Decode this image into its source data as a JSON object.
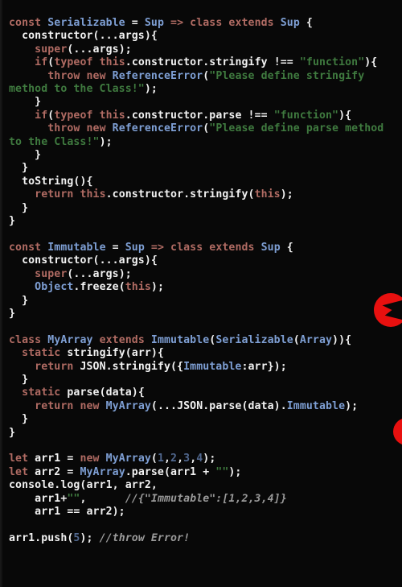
{
  "editor": {
    "language": "javascript",
    "theme": "dark",
    "background_color": "#080808",
    "foreground_color": "#f2f2f2",
    "palette": {
      "keyword": "#b06b63",
      "type": "#7e9fd4",
      "string": "#3f7a3f",
      "number": "#51688f",
      "comment": "#9a9a9a",
      "plain": "#f2f2f2"
    }
  },
  "overlay": {
    "logos": [
      {
        "name": "red-circle-logo-upper",
        "color": "#e8100f"
      },
      {
        "name": "red-circle-logo-lower",
        "color": "#e8100f"
      }
    ]
  },
  "code": {
    "lines": [
      {
        "n": 1,
        "tokens": [
          {
            "t": "const",
            "c": "kw"
          },
          {
            "t": " ",
            "c": "plain"
          },
          {
            "t": "Serializable",
            "c": "type"
          },
          {
            "t": " = ",
            "c": "plain"
          },
          {
            "t": "Sup",
            "c": "type"
          },
          {
            "t": " ",
            "c": "plain"
          },
          {
            "t": "=>",
            "c": "kw"
          },
          {
            "t": " ",
            "c": "plain"
          },
          {
            "t": "class",
            "c": "kw"
          },
          {
            "t": " ",
            "c": "plain"
          },
          {
            "t": "extends",
            "c": "kw"
          },
          {
            "t": " ",
            "c": "plain"
          },
          {
            "t": "Sup",
            "c": "type"
          },
          {
            "t": " {",
            "c": "plain"
          }
        ]
      },
      {
        "n": 2,
        "tokens": [
          {
            "t": "  constructor(...args){",
            "c": "plain"
          }
        ]
      },
      {
        "n": 3,
        "tokens": [
          {
            "t": "    ",
            "c": "plain"
          },
          {
            "t": "super",
            "c": "kw"
          },
          {
            "t": "(...args);",
            "c": "plain"
          }
        ]
      },
      {
        "n": 4,
        "tokens": [
          {
            "t": "    ",
            "c": "plain"
          },
          {
            "t": "if",
            "c": "kw"
          },
          {
            "t": "(",
            "c": "plain"
          },
          {
            "t": "typeof",
            "c": "kw"
          },
          {
            "t": " ",
            "c": "plain"
          },
          {
            "t": "this",
            "c": "kw"
          },
          {
            "t": ".constructor.stringify !== ",
            "c": "plain"
          },
          {
            "t": "\"function\"",
            "c": "str"
          },
          {
            "t": "){",
            "c": "plain"
          }
        ]
      },
      {
        "n": 5,
        "tokens": [
          {
            "t": "      ",
            "c": "plain"
          },
          {
            "t": "throw",
            "c": "kw"
          },
          {
            "t": " ",
            "c": "plain"
          },
          {
            "t": "new",
            "c": "kw"
          },
          {
            "t": " ",
            "c": "plain"
          },
          {
            "t": "ReferenceError",
            "c": "type"
          },
          {
            "t": "(",
            "c": "plain"
          },
          {
            "t": "\"Please define stringify method to the Class!\"",
            "c": "str"
          },
          {
            "t": ");",
            "c": "plain"
          }
        ]
      },
      {
        "n": 6,
        "tokens": [
          {
            "t": "    }",
            "c": "plain"
          }
        ]
      },
      {
        "n": 7,
        "tokens": [
          {
            "t": "    ",
            "c": "plain"
          },
          {
            "t": "if",
            "c": "kw"
          },
          {
            "t": "(",
            "c": "plain"
          },
          {
            "t": "typeof",
            "c": "kw"
          },
          {
            "t": " ",
            "c": "plain"
          },
          {
            "t": "this",
            "c": "kw"
          },
          {
            "t": ".constructor.parse !== ",
            "c": "plain"
          },
          {
            "t": "\"function\"",
            "c": "str"
          },
          {
            "t": "){",
            "c": "plain"
          }
        ]
      },
      {
        "n": 8,
        "tokens": [
          {
            "t": "      ",
            "c": "plain"
          },
          {
            "t": "throw",
            "c": "kw"
          },
          {
            "t": " ",
            "c": "plain"
          },
          {
            "t": "new",
            "c": "kw"
          },
          {
            "t": " ",
            "c": "plain"
          },
          {
            "t": "ReferenceError",
            "c": "type"
          },
          {
            "t": "(",
            "c": "plain"
          },
          {
            "t": "\"Please define parse method to the Class!\"",
            "c": "str"
          },
          {
            "t": ");",
            "c": "plain"
          }
        ]
      },
      {
        "n": 9,
        "tokens": [
          {
            "t": "    }",
            "c": "plain"
          }
        ]
      },
      {
        "n": 10,
        "tokens": [
          {
            "t": "  }",
            "c": "plain"
          }
        ]
      },
      {
        "n": 11,
        "tokens": [
          {
            "t": "  toString(){",
            "c": "plain"
          }
        ]
      },
      {
        "n": 12,
        "tokens": [
          {
            "t": "    ",
            "c": "plain"
          },
          {
            "t": "return",
            "c": "kw"
          },
          {
            "t": " ",
            "c": "plain"
          },
          {
            "t": "this",
            "c": "kw"
          },
          {
            "t": ".constructor.stringify(",
            "c": "plain"
          },
          {
            "t": "this",
            "c": "kw"
          },
          {
            "t": ");",
            "c": "plain"
          }
        ]
      },
      {
        "n": 13,
        "tokens": [
          {
            "t": "  }",
            "c": "plain"
          }
        ]
      },
      {
        "n": 14,
        "tokens": [
          {
            "t": "}",
            "c": "plain"
          }
        ]
      },
      {
        "n": 15,
        "tokens": []
      },
      {
        "n": 16,
        "tokens": [
          {
            "t": "const",
            "c": "kw"
          },
          {
            "t": " ",
            "c": "plain"
          },
          {
            "t": "Immutable",
            "c": "type"
          },
          {
            "t": " = ",
            "c": "plain"
          },
          {
            "t": "Sup",
            "c": "type"
          },
          {
            "t": " ",
            "c": "plain"
          },
          {
            "t": "=>",
            "c": "kw"
          },
          {
            "t": " ",
            "c": "plain"
          },
          {
            "t": "class",
            "c": "kw"
          },
          {
            "t": " ",
            "c": "plain"
          },
          {
            "t": "extends",
            "c": "kw"
          },
          {
            "t": " ",
            "c": "plain"
          },
          {
            "t": "Sup",
            "c": "type"
          },
          {
            "t": " {",
            "c": "plain"
          }
        ]
      },
      {
        "n": 17,
        "tokens": [
          {
            "t": "  constructor(...args){",
            "c": "plain"
          }
        ]
      },
      {
        "n": 18,
        "tokens": [
          {
            "t": "    ",
            "c": "plain"
          },
          {
            "t": "super",
            "c": "kw"
          },
          {
            "t": "(...args);",
            "c": "plain"
          }
        ]
      },
      {
        "n": 19,
        "tokens": [
          {
            "t": "    ",
            "c": "plain"
          },
          {
            "t": "Object",
            "c": "type"
          },
          {
            "t": ".freeze(",
            "c": "plain"
          },
          {
            "t": "this",
            "c": "kw"
          },
          {
            "t": ");",
            "c": "plain"
          }
        ]
      },
      {
        "n": 20,
        "tokens": [
          {
            "t": "  }",
            "c": "plain"
          }
        ]
      },
      {
        "n": 21,
        "tokens": [
          {
            "t": "}",
            "c": "plain"
          }
        ]
      },
      {
        "n": 22,
        "tokens": []
      },
      {
        "n": 23,
        "tokens": [
          {
            "t": "class",
            "c": "kw"
          },
          {
            "t": " ",
            "c": "plain"
          },
          {
            "t": "MyArray",
            "c": "type"
          },
          {
            "t": " ",
            "c": "plain"
          },
          {
            "t": "extends",
            "c": "kw"
          },
          {
            "t": " ",
            "c": "plain"
          },
          {
            "t": "Immutable",
            "c": "type"
          },
          {
            "t": "(",
            "c": "plain"
          },
          {
            "t": "Serializable",
            "c": "type"
          },
          {
            "t": "(",
            "c": "plain"
          },
          {
            "t": "Array",
            "c": "type"
          },
          {
            "t": ")){",
            "c": "plain"
          }
        ]
      },
      {
        "n": 24,
        "tokens": [
          {
            "t": "  ",
            "c": "plain"
          },
          {
            "t": "static",
            "c": "kw"
          },
          {
            "t": " stringify(arr){",
            "c": "plain"
          }
        ]
      },
      {
        "n": 25,
        "tokens": [
          {
            "t": "    ",
            "c": "plain"
          },
          {
            "t": "return",
            "c": "kw"
          },
          {
            "t": " JSON.stringify({",
            "c": "plain"
          },
          {
            "t": "Immutable",
            "c": "type"
          },
          {
            "t": ":arr});",
            "c": "plain"
          }
        ]
      },
      {
        "n": 26,
        "tokens": [
          {
            "t": "  }",
            "c": "plain"
          }
        ]
      },
      {
        "n": 27,
        "tokens": [
          {
            "t": "  ",
            "c": "plain"
          },
          {
            "t": "static",
            "c": "kw"
          },
          {
            "t": " parse(data){",
            "c": "plain"
          }
        ]
      },
      {
        "n": 28,
        "tokens": [
          {
            "t": "    ",
            "c": "plain"
          },
          {
            "t": "return",
            "c": "kw"
          },
          {
            "t": " ",
            "c": "plain"
          },
          {
            "t": "new",
            "c": "kw"
          },
          {
            "t": " ",
            "c": "plain"
          },
          {
            "t": "MyArray",
            "c": "type"
          },
          {
            "t": "(...JSON.parse(data).",
            "c": "plain"
          },
          {
            "t": "Immutable",
            "c": "type"
          },
          {
            "t": ");",
            "c": "plain"
          }
        ]
      },
      {
        "n": 29,
        "tokens": [
          {
            "t": "  }",
            "c": "plain"
          }
        ]
      },
      {
        "n": 30,
        "tokens": [
          {
            "t": "}",
            "c": "plain"
          }
        ]
      },
      {
        "n": 31,
        "tokens": []
      },
      {
        "n": 32,
        "tokens": [
          {
            "t": "let",
            "c": "kw"
          },
          {
            "t": " arr1 = ",
            "c": "plain"
          },
          {
            "t": "new",
            "c": "kw"
          },
          {
            "t": " ",
            "c": "plain"
          },
          {
            "t": "MyArray",
            "c": "type"
          },
          {
            "t": "(",
            "c": "plain"
          },
          {
            "t": "1",
            "c": "num"
          },
          {
            "t": ",",
            "c": "plain"
          },
          {
            "t": "2",
            "c": "num"
          },
          {
            "t": ",",
            "c": "plain"
          },
          {
            "t": "3",
            "c": "num"
          },
          {
            "t": ",",
            "c": "plain"
          },
          {
            "t": "4",
            "c": "num"
          },
          {
            "t": ");",
            "c": "plain"
          }
        ]
      },
      {
        "n": 33,
        "tokens": [
          {
            "t": "let",
            "c": "kw"
          },
          {
            "t": " arr2 = ",
            "c": "plain"
          },
          {
            "t": "MyArray",
            "c": "type"
          },
          {
            "t": ".parse(arr1 + ",
            "c": "plain"
          },
          {
            "t": "\"\"",
            "c": "str"
          },
          {
            "t": ");",
            "c": "plain"
          }
        ]
      },
      {
        "n": 34,
        "tokens": [
          {
            "t": "console.log(arr1, arr2,",
            "c": "plain"
          }
        ]
      },
      {
        "n": 35,
        "tokens": [
          {
            "t": "    arr1+",
            "c": "plain"
          },
          {
            "t": "\"\"",
            "c": "str"
          },
          {
            "t": ",      ",
            "c": "plain"
          },
          {
            "t": "//{\"Immutable\":[1,2,3,4]}",
            "c": "com"
          }
        ]
      },
      {
        "n": 36,
        "tokens": [
          {
            "t": "    arr1 == arr2);",
            "c": "plain"
          }
        ]
      },
      {
        "n": 37,
        "tokens": []
      },
      {
        "n": 38,
        "tokens": [
          {
            "t": "arr1.push(",
            "c": "plain"
          },
          {
            "t": "5",
            "c": "num"
          },
          {
            "t": "); ",
            "c": "plain"
          },
          {
            "t": "//throw Error!",
            "c": "com"
          }
        ]
      }
    ]
  }
}
